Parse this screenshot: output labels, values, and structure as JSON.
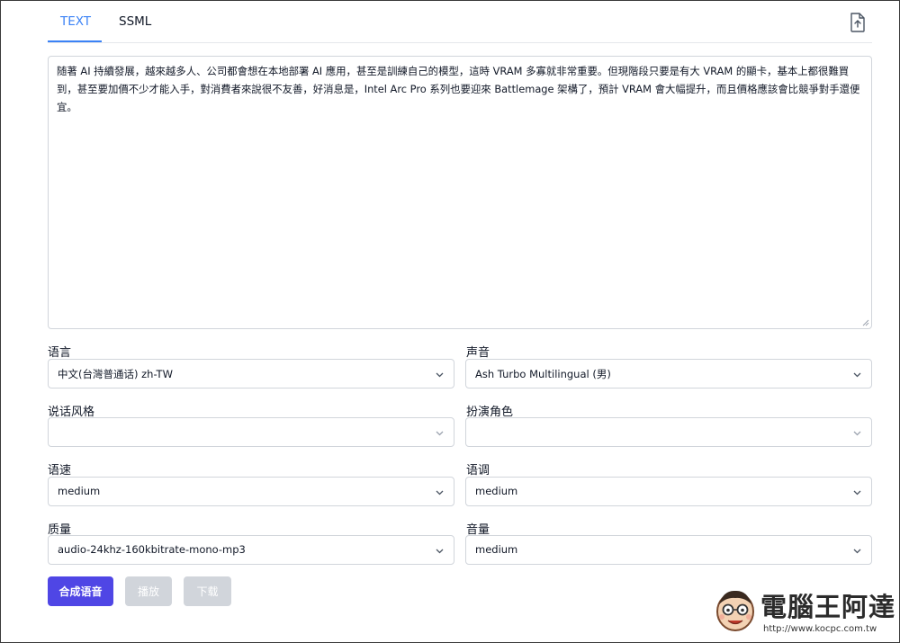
{
  "tabs": [
    {
      "label": "TEXT",
      "active": true
    },
    {
      "label": "SSML",
      "active": false
    }
  ],
  "text_input": {
    "value": "随著 AI 持續發展，越來越多人、公司都會想在本地部署 AI 應用，甚至是訓練自己的模型，這時 VRAM 多寡就非常重要。但現階段只要是有大 VRAM 的顯卡，基本上都很難買到，甚至要加價不少才能入手，對消費者來說很不友善，好消息是，Intel Arc Pro 系列也要迎來 Battlemage 架構了，預計 VRAM 會大幅提升，而且價格應該會比競爭對手還便宜。"
  },
  "fields": {
    "language": {
      "label": "语言",
      "value": "中文(台灣普通话) zh-TW"
    },
    "voice": {
      "label": "声音",
      "value": "Ash Turbo Multilingual (男)"
    },
    "style": {
      "label": "说话风格",
      "value": ""
    },
    "role": {
      "label": "扮演角色",
      "value": ""
    },
    "rate": {
      "label": "语速",
      "value": "medium"
    },
    "pitch": {
      "label": "语调",
      "value": "medium"
    },
    "quality": {
      "label": "质量",
      "value": "audio-24khz-160kbitrate-mono-mp3"
    },
    "volume": {
      "label": "音量",
      "value": "medium"
    }
  },
  "buttons": {
    "synthesize": "合成语音",
    "play": "播放",
    "download": "下载"
  },
  "watermark": {
    "title": "電腦王阿達",
    "url": "http://www.kocpc.com.tw"
  },
  "colors": {
    "accent": "#3b82f6",
    "primary_button": "#4f46e5",
    "disabled_button": "#d1d5db"
  },
  "icons": {
    "upload": "file-upload-icon",
    "dropdown": "chevron-down-icon"
  }
}
